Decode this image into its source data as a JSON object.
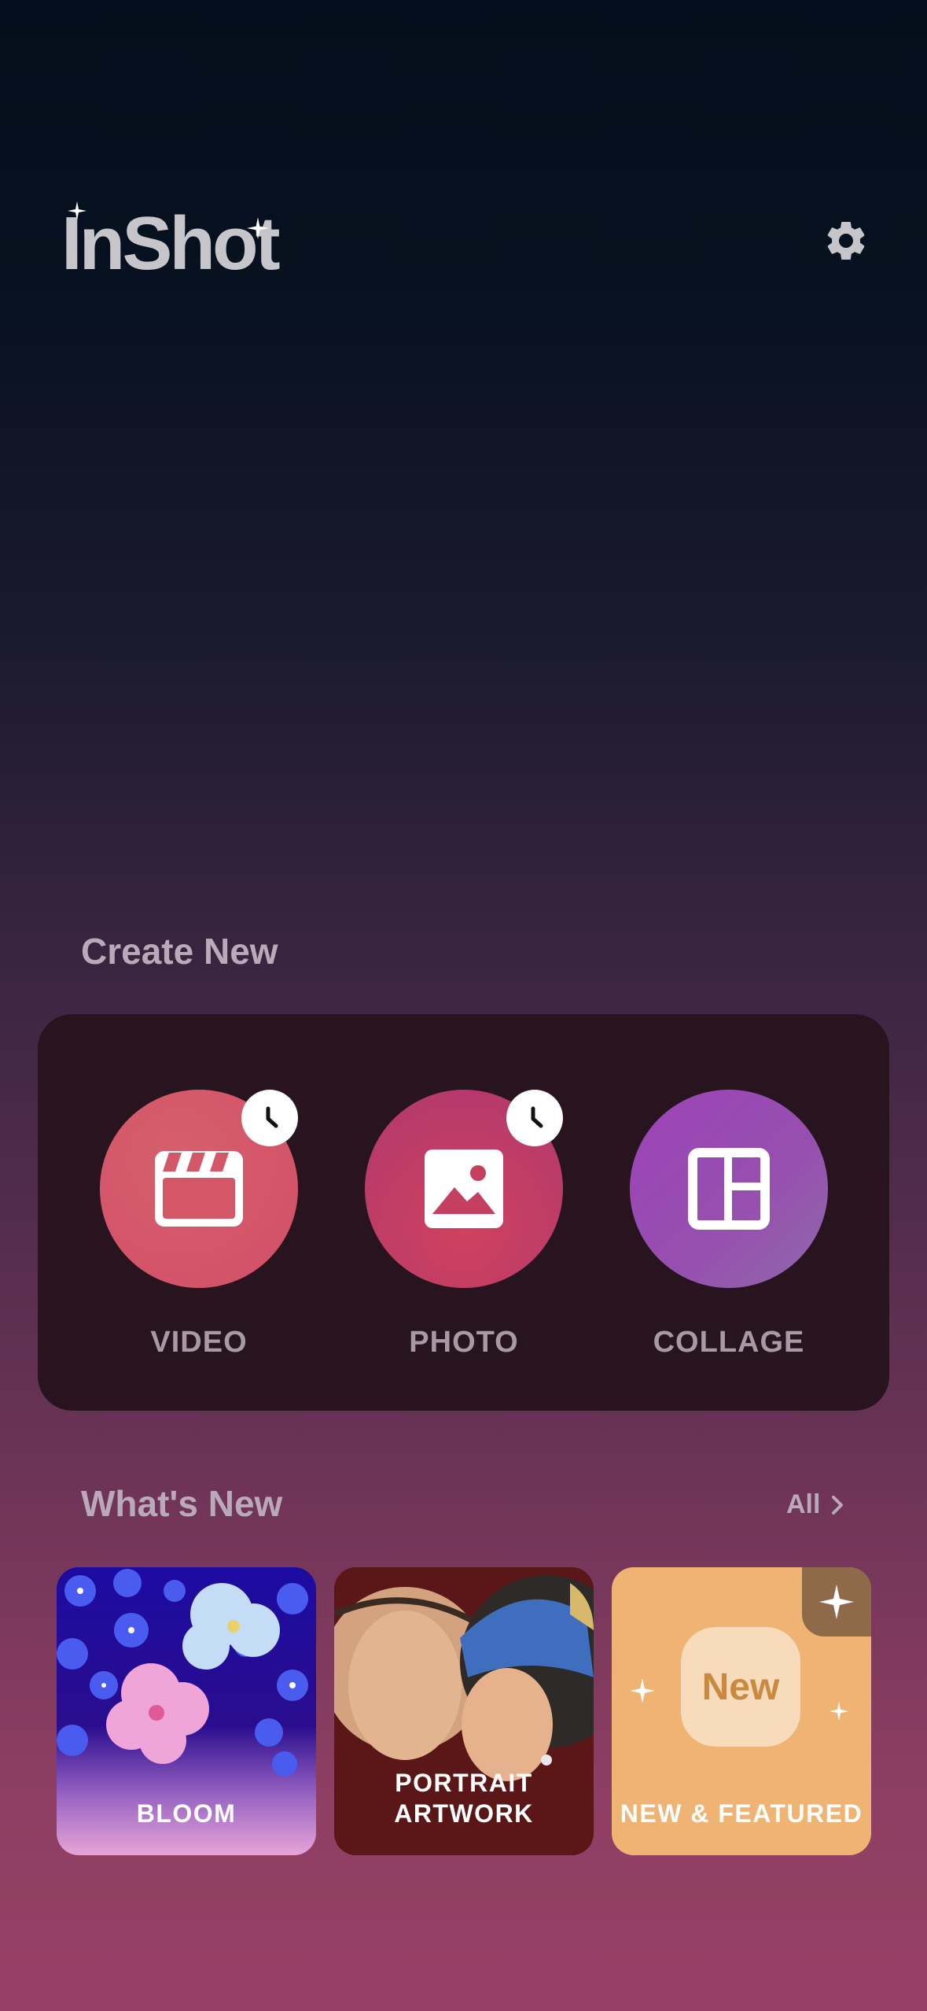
{
  "header": {
    "logo_text": "InShot",
    "settings_icon": "gear-icon"
  },
  "create_new": {
    "title": "Create New",
    "actions": [
      {
        "label": "VIDEO",
        "icon": "clapperboard-icon",
        "badge_icon": "clock-icon",
        "color": "#d45a68"
      },
      {
        "label": "PHOTO",
        "icon": "image-icon",
        "badge_icon": "clock-icon",
        "color": "#c44265"
      },
      {
        "label": "COLLAGE",
        "icon": "collage-layout-icon",
        "color": "#9b4cb0"
      }
    ]
  },
  "whats_new": {
    "title": "What's New",
    "all_label": "All",
    "tiles": [
      {
        "label": "BLOOM"
      },
      {
        "label_line1": "PORTRAIT",
        "label_line2": "ARTWORK"
      },
      {
        "badge_text": "New",
        "label": "NEW & FEATURED"
      }
    ]
  },
  "colors": {
    "accent_orange": "#efb474",
    "card_bg": "#27141f",
    "text_muted": "#b9a9b9"
  }
}
